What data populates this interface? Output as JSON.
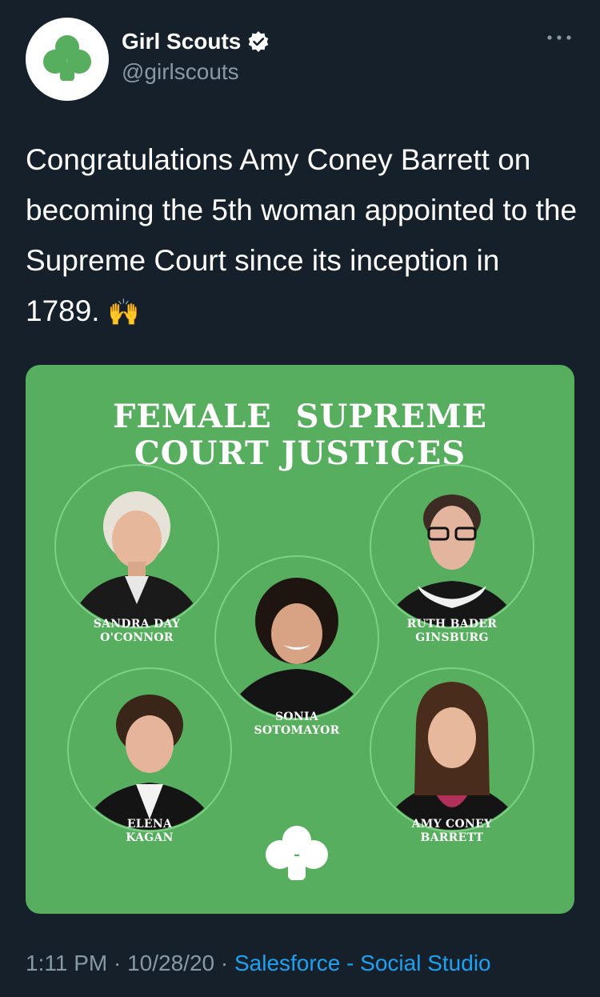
{
  "author": {
    "display_name": "Girl Scouts",
    "handle": "@girlscouts",
    "verified": true,
    "avatar_icon": "trefoil-logo-icon",
    "brand_color": "#57ae5e"
  },
  "tweet": {
    "text": "Congratulations Amy Coney Barrett on becoming the 5th woman appointed to the Supreme Court since its inception in 1789.",
    "emoji": "🙌"
  },
  "media": {
    "title_line1": "FEMALE  SUPREME",
    "title_line2": "COURT JUSTICES",
    "background_color": "#57ae5e",
    "justices": [
      {
        "line1": "SANDRA DAY",
        "line2": "O'CONNOR"
      },
      {
        "line1": "RUTH BADER",
        "line2": "GINSBURG"
      },
      {
        "line1": "SONIA",
        "line2": "SOTOMAYOR"
      },
      {
        "line1": "ELENA",
        "line2": "KAGAN"
      },
      {
        "line1": "AMY CONEY",
        "line2": "BARRETT"
      }
    ]
  },
  "meta": {
    "time": "1:11 PM",
    "separator": " · ",
    "date": "10/28/20",
    "source_part1": "Salesforce",
    "source_dash": " - ",
    "source_part2": "Social Studio"
  }
}
